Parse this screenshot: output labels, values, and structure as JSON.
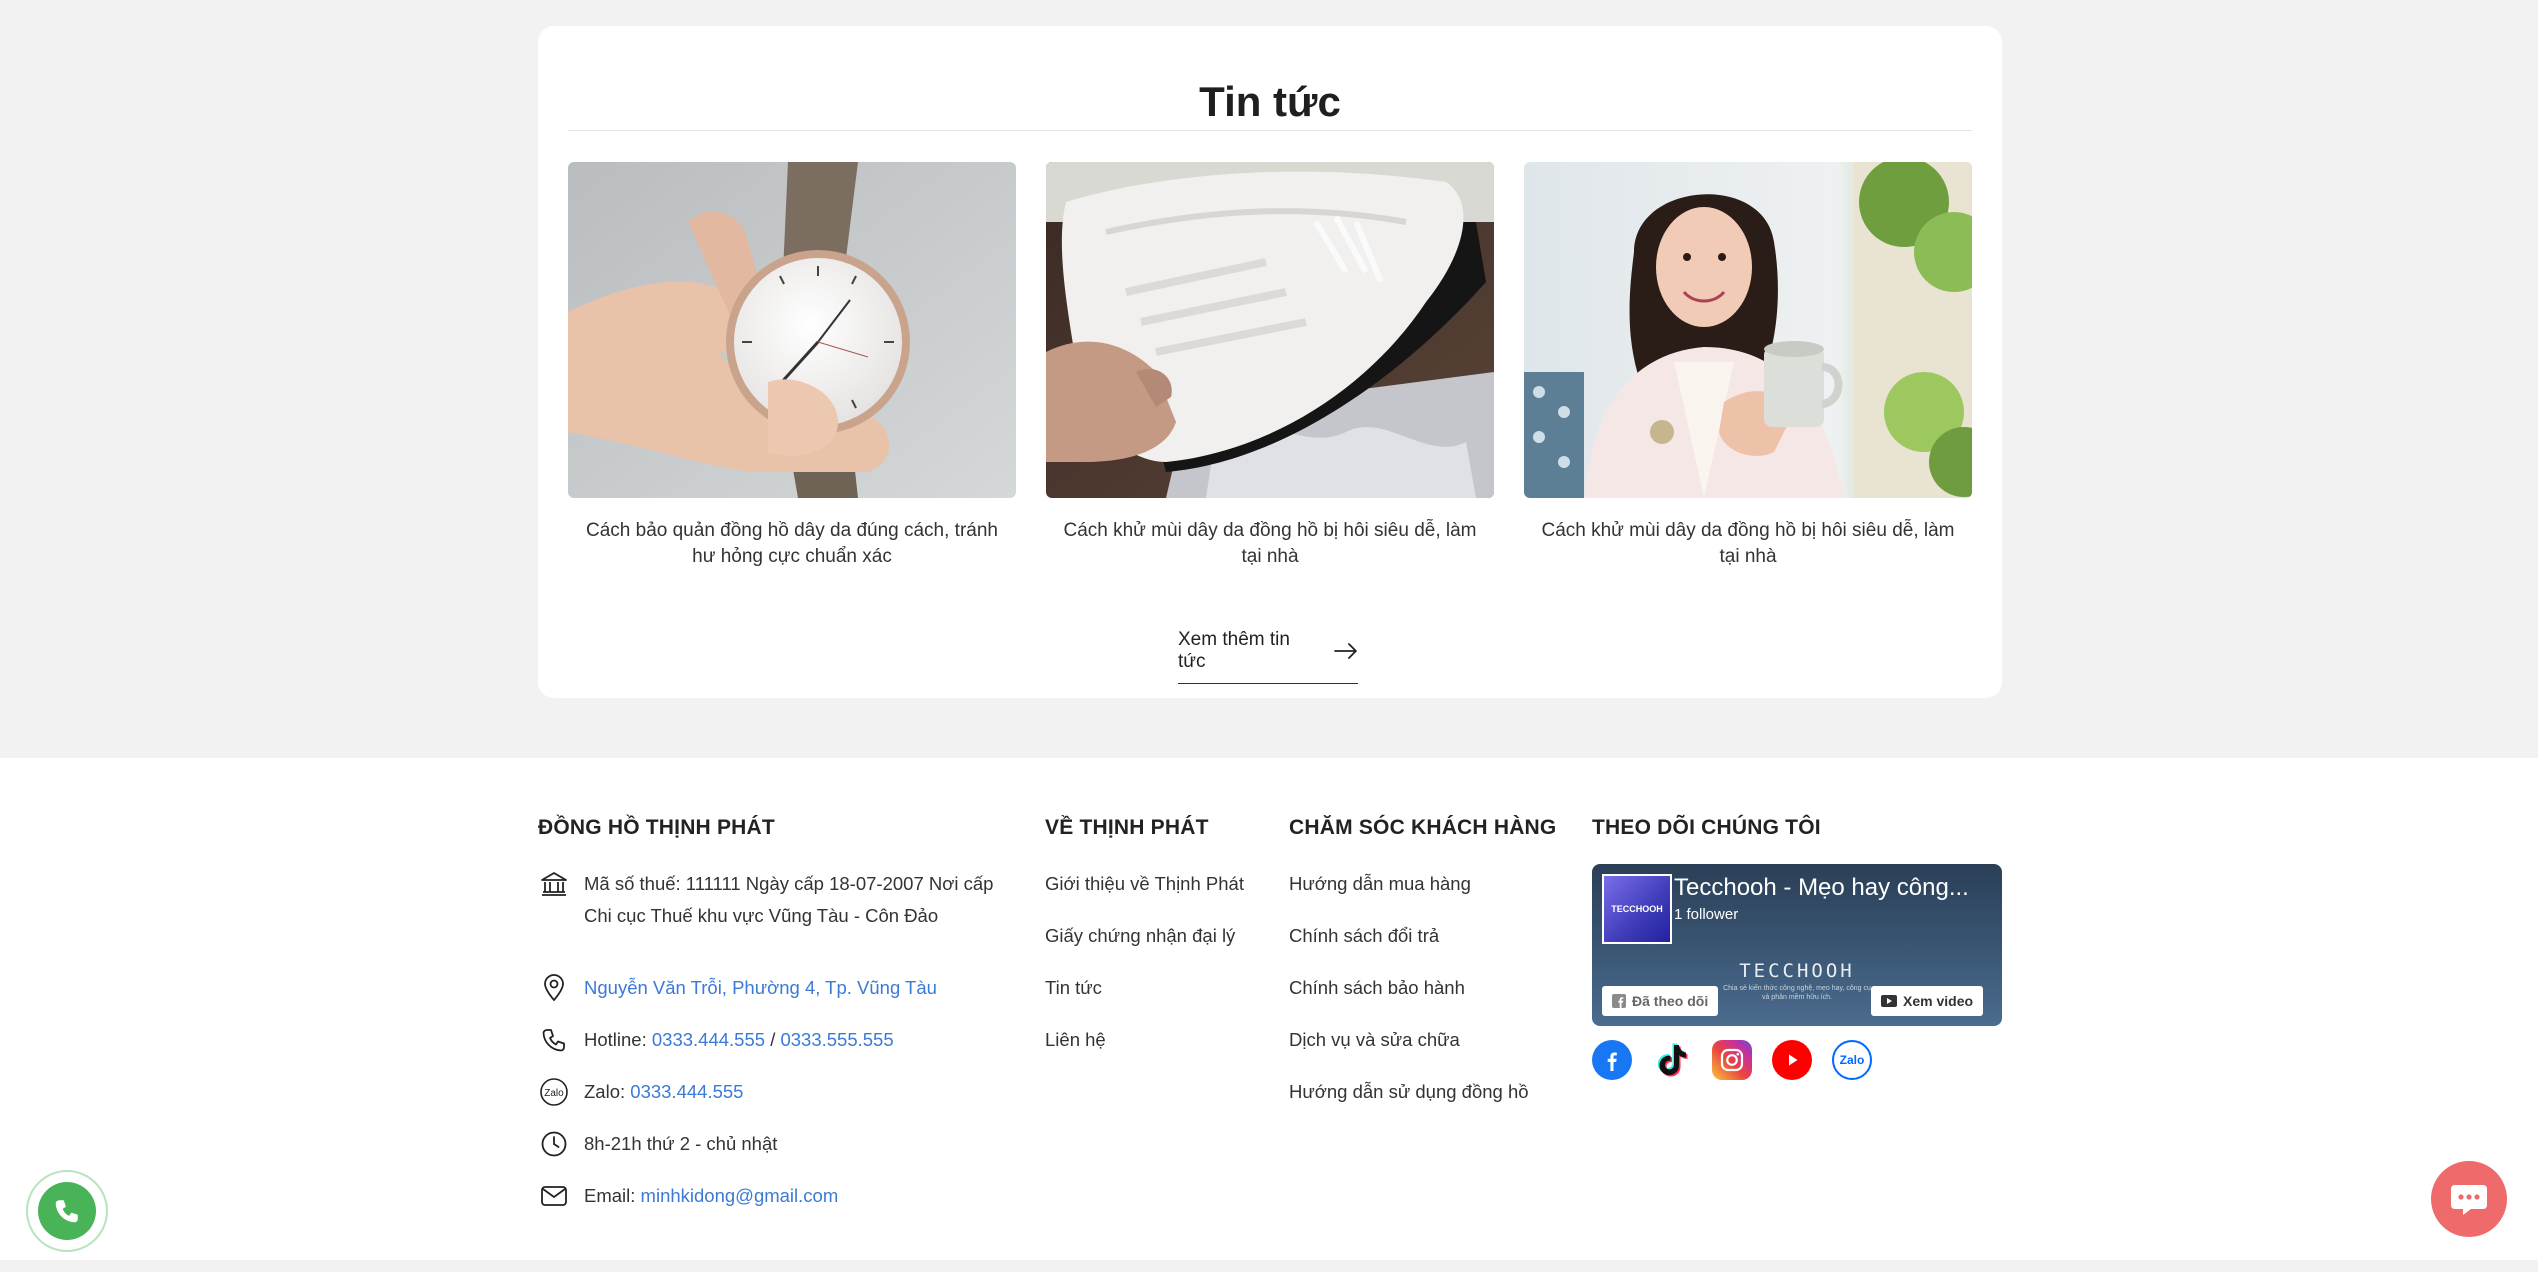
{
  "news": {
    "title": "Tin tức",
    "articles": [
      {
        "caption": "Cách bảo quản đồng hồ dây da đúng cách, tránh hư hỏng cực chuẩn xác"
      },
      {
        "caption": "Cách khử mùi dây da đồng hồ bị hôi siêu dễ, làm tại nhà"
      },
      {
        "caption": "Cách khử mùi dây da đồng hồ bị hôi siêu dễ, làm tại nhà"
      }
    ],
    "more_label": "Xem thêm tin tức"
  },
  "footer": {
    "company": {
      "title": "ĐỒNG HỒ THỊNH PHÁT",
      "tax_line1": "Mã số thuế: 111111 Ngày cấp 18-07-2007 Nơi cấp",
      "tax_line2": "Chi cục Thuế khu vực Vũng Tàu - Côn Đảo",
      "address": "Nguyễn Văn Trỗi, Phường 4, Tp. Vũng Tàu",
      "hotline_label": "Hotline:",
      "hotline_1": "0333.444.555",
      "hotline_sep": "/",
      "hotline_2": "0333.555.555",
      "zalo_label": "Zalo:",
      "zalo_number": "0333.444.555",
      "hours": "8h-21h thứ 2 - chủ nhật",
      "email_label": "Email:",
      "email": "minhkidong@gmail.com"
    },
    "about": {
      "title": "VỀ THỊNH PHÁT",
      "links": [
        "Giới thiệu về Thịnh Phát",
        "Giấy chứng nhận đại lý",
        "Tin tức",
        "Liên hệ"
      ]
    },
    "care": {
      "title": "CHĂM SÓC KHÁCH HÀNG",
      "links": [
        "Hướng dẫn mua hàng",
        "Chính sách đổi trả",
        "Chính sách bảo hành",
        "Dịch vụ và sửa chữa",
        "Hướng dẫn sử dụng đồng hồ"
      ]
    },
    "follow": {
      "title": "THEO DÕI CHÚNG TÔI",
      "fb_page_name": "Tecchooh - Mẹo hay công...",
      "fb_followers": "1 follower",
      "fb_avatar_text": "TECCHOOH",
      "fb_brand": "TECCHOOH",
      "fb_tagline": "Chia sẻ kiến thức công nghệ, mẹo hay, công cụ và phần mềm hữu ích.",
      "fb_followed_label": "Đã theo dõi",
      "fb_watch_label": "Xem video",
      "socials": [
        "facebook-icon",
        "tiktok-icon",
        "instagram-icon",
        "youtube-icon",
        "zalo-icon"
      ],
      "zalo_badge": "Zalo"
    }
  },
  "colors": {
    "link": "#3b7ad6",
    "call_button": "#48b357",
    "chat_button": "#ef6b6b",
    "background": "#f2f2f2"
  }
}
